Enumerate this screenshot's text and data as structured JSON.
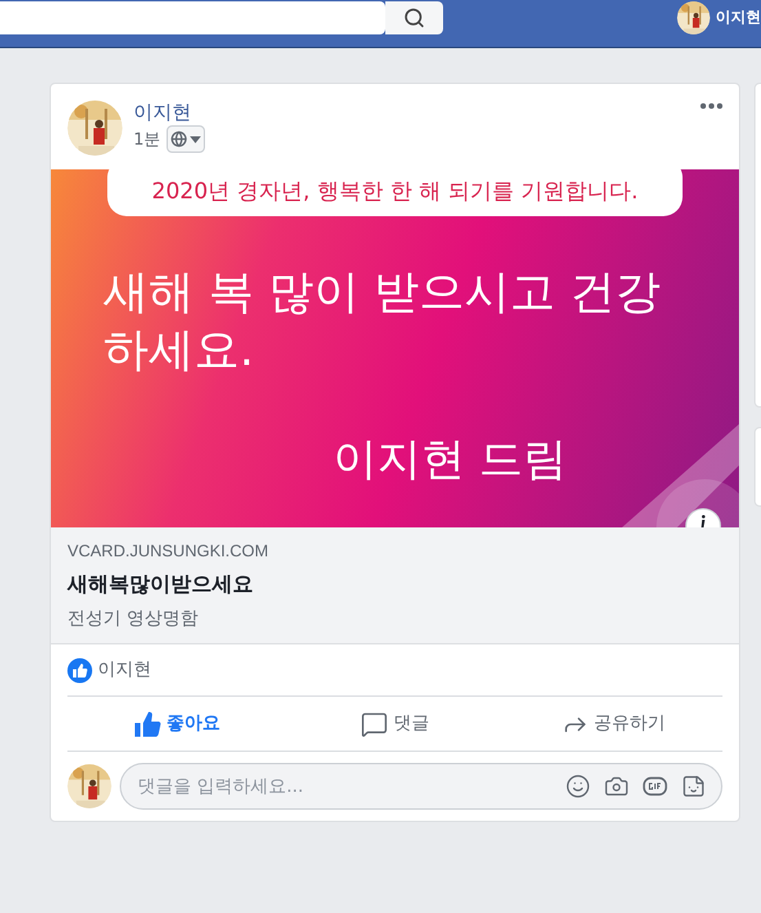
{
  "topbar": {
    "user_name": "이지현"
  },
  "post": {
    "author": "이지현",
    "time": "1분",
    "link": {
      "banner_top": "2020년 경자년, 행복한 한 해 되기를 기원합니다.",
      "banner_main": "새해 복 많이 받으시고 건강하세요.",
      "banner_sign": "이지현 드림",
      "domain": "VCARD.JUNSUNGKI.COM",
      "title": "새해복많이받으세요",
      "description": "전성기 영상명함"
    },
    "likers": "이지현",
    "actions": [
      {
        "kind": "like",
        "label": "좋아요",
        "selected": true
      },
      {
        "kind": "comment",
        "label": "댓글",
        "selected": false
      },
      {
        "kind": "share",
        "label": "공유하기",
        "selected": false
      }
    ],
    "comment_box": {
      "placeholder": "댓글을 입력하세요..."
    }
  }
}
